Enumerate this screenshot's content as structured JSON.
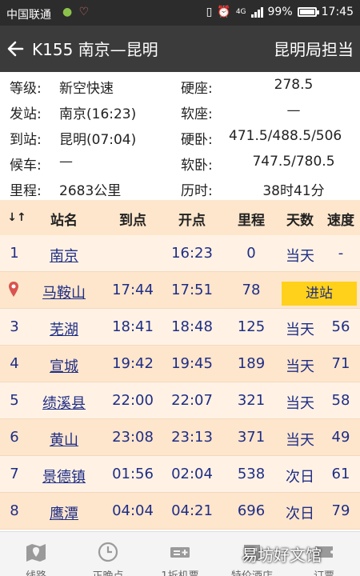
{
  "status_bar": {
    "carrier": "中国联通",
    "battery": "99%",
    "time": "17:45",
    "network": "4G"
  },
  "header": {
    "title": "K155 南京—昆明",
    "bureau": "昆明局担当"
  },
  "info": {
    "left": [
      {
        "label": "等级:",
        "value": "新空快速"
      },
      {
        "label": "发站:",
        "value": "南京(16:23)"
      },
      {
        "label": "到站:",
        "value": "昆明(07:04)"
      },
      {
        "label": "候车:",
        "value": "—"
      },
      {
        "label": "里程:",
        "value": "2683公里"
      }
    ],
    "right": [
      {
        "label": "硬座:",
        "value": "278.5"
      },
      {
        "label": "软座:",
        "value": "—"
      },
      {
        "label": "硬卧:",
        "value": "471.5/488.5/506"
      },
      {
        "label": "软卧:",
        "value": "747.5/780.5"
      },
      {
        "label": "历时:",
        "value": "38时41分"
      }
    ]
  },
  "table": {
    "headers": {
      "sort": "↓↑",
      "name": "站名",
      "arrive": "到点",
      "depart": "开点",
      "distance": "里程",
      "days": "天数",
      "speed": "速度"
    },
    "rows": [
      {
        "idx": "1",
        "name": "南京",
        "arrive": "",
        "depart": "16:23",
        "distance": "0",
        "day": "当天",
        "speed": "-"
      },
      {
        "idx": "",
        "name": "马鞍山",
        "arrive": "17:44",
        "depart": "17:51",
        "distance": "78",
        "status": "进站"
      },
      {
        "idx": "3",
        "name": "芜湖",
        "arrive": "18:41",
        "depart": "18:48",
        "distance": "125",
        "day": "当天",
        "speed": "56"
      },
      {
        "idx": "4",
        "name": "宣城",
        "arrive": "19:42",
        "depart": "19:45",
        "distance": "189",
        "day": "当天",
        "speed": "71"
      },
      {
        "idx": "5",
        "name": "绩溪县",
        "arrive": "22:00",
        "depart": "22:07",
        "distance": "321",
        "day": "当天",
        "speed": "58"
      },
      {
        "idx": "6",
        "name": "黄山",
        "arrive": "23:08",
        "depart": "23:13",
        "distance": "371",
        "day": "当天",
        "speed": "49"
      },
      {
        "idx": "7",
        "name": "景德镇",
        "arrive": "01:56",
        "depart": "02:04",
        "distance": "538",
        "day": "次日",
        "speed": "61"
      },
      {
        "idx": "8",
        "name": "鹰潭",
        "arrive": "04:04",
        "depart": "04:21",
        "distance": "696",
        "day": "次日",
        "speed": "79"
      }
    ]
  },
  "bottom_nav": [
    {
      "label": "线路",
      "icon": "map-pin-icon"
    },
    {
      "label": "正晚点",
      "icon": "clock-icon"
    },
    {
      "label": "1折机票",
      "icon": "ticket-plus-icon"
    },
    {
      "label": "特价酒店",
      "icon": "hotel-icon"
    },
    {
      "label": "订票",
      "icon": "ticket-icon"
    }
  ],
  "watermark": "易坊好文馆",
  "colors": {
    "header_bg": "#3b3b3b",
    "row_odd": "#fde6cc",
    "row_even": "#fff2e4",
    "link_blue": "#1f2d86",
    "status_badge": "#ffd11a"
  }
}
